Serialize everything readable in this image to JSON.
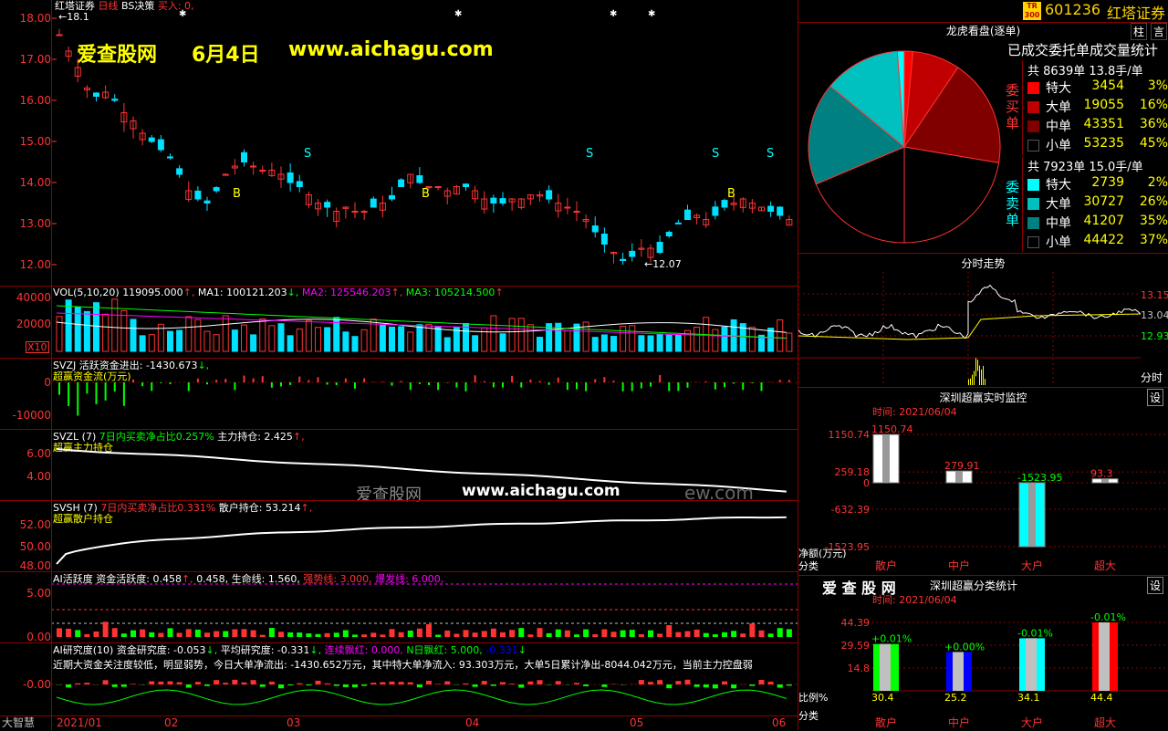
{
  "window": {
    "title": "红塔证券",
    "period": "日线",
    "strategy": "BS决策",
    "buy_label": "买入: 0,"
  },
  "header_right": {
    "code": "601236",
    "name": "红塔证券",
    "badge": "TR 300"
  },
  "watermark": {
    "site": "爱查股网",
    "date": "6月4日",
    "url": "www.aichagu.com",
    "mid_text": "爱查股网",
    "mid_url": "www.aichagu.com",
    "mid_tail": "ew.com"
  },
  "price_panel": {
    "y_ticks": [
      "18.00",
      "17.00",
      "16.00",
      "15.00",
      "14.00",
      "13.00",
      "12.00"
    ],
    "high_marker": "18.1",
    "low_marker": "12.07"
  },
  "vol_panel": {
    "label": "VOL(5,10,20)",
    "value": "119095.000",
    "ma1": "MA1: 100121.203",
    "ma2": "MA2: 125546.203",
    "ma3": "MA3: 105214.500",
    "y_ticks": [
      "40000",
      "20000"
    ],
    "unit": "X10"
  },
  "svzj_panel": {
    "label": "SVZJ  活跃资金进出: -1430.673",
    "sub": "超赢资金流(万元)",
    "y_ticks": [
      "0",
      "-10000"
    ]
  },
  "svzl_panel": {
    "label": "SVZL (7)",
    "ratio": "7日内买卖净占比0.257%",
    "hold": "主力持仓: 2.425",
    "sub": "超赢主力持仓",
    "y_ticks": [
      "6.00",
      "4.00"
    ]
  },
  "svsh_panel": {
    "label": "SVSH (7)",
    "ratio": "7日内买卖净占比0.331%",
    "hold": "散户持仓: 53.214",
    "sub": "超赢散户持仓",
    "y_ticks": [
      "52.00",
      "50.00",
      "48.00"
    ]
  },
  "ai_panel": {
    "label": "AI活跃度  资金活跃度: 0.458",
    "v2": "0.458,",
    "life": "生命线: 1.560,",
    "strong": "强势线: 3.000,",
    "burst": "爆发线: 6.000,",
    "y_ticks": [
      "5.00",
      "0.00"
    ]
  },
  "research_panel": {
    "label": "AI研究度(10) 资金研究度: -0.053",
    "avg": "平均研究度: -0.331",
    "red": "连续飘红: 0.000,",
    "nred": "N日飘红: 5.000,",
    "last": "-0.331",
    "note": "近期大资金关注度较低，明显弱势，今日大单净流出: -1430.652万元，其中特大单净流入: 93.303万元，大单5日累计净出-8044.042万元，当前主力控盘弱",
    "y_tick": "-0.00"
  },
  "x_axis": {
    "corner": "大智慧",
    "labels": [
      "2021/01",
      "02",
      "03",
      "04",
      "05",
      "06"
    ]
  },
  "dragon": {
    "title": "龙虎看盘(逐单)",
    "tab1": "柱",
    "tab2": "言",
    "subtitle": "已成交委托单成交量统计",
    "buy": {
      "side": "委买单",
      "total": "共 8639单 13.8手/单",
      "rows": [
        {
          "name": "特大",
          "value": "3454",
          "pct": "3%",
          "color": "#ff0000"
        },
        {
          "name": "大单",
          "value": "19055",
          "pct": "16%",
          "color": "#c00000"
        },
        {
          "name": "中单",
          "value": "43351",
          "pct": "36%",
          "color": "#800000"
        },
        {
          "name": "小单",
          "value": "53235",
          "pct": "45%",
          "color": "#000000"
        }
      ]
    },
    "sell": {
      "side": "委卖单",
      "total": "共 7923单 15.0手/单",
      "rows": [
        {
          "name": "特大",
          "value": "2739",
          "pct": "2%",
          "color": "#00ffff"
        },
        {
          "name": "大单",
          "value": "30727",
          "pct": "26%",
          "color": "#00c0c0"
        },
        {
          "name": "中单",
          "value": "41207",
          "pct": "35%",
          "color": "#008080"
        },
        {
          "name": "小单",
          "value": "44422",
          "pct": "37%",
          "color": "#000000"
        }
      ]
    }
  },
  "intraday": {
    "title": "分时走势",
    "y_ticks": [
      "13.15",
      "13.04",
      "12.935"
    ],
    "vol_label": "分时"
  },
  "realtime": {
    "title": "深圳超赢实时监控",
    "btn": "设",
    "time": "时间: 2021/06/04",
    "y_ticks": [
      "1150.74",
      "259.18",
      "0",
      "-632.39",
      "-1523.95"
    ],
    "y_label": "净额(万元)",
    "x_label": "分类",
    "categories": [
      "散户",
      "中户",
      "大户",
      "超大"
    ],
    "values": [
      1150.74,
      279.91,
      -1523.95,
      93.3
    ],
    "value_labels": [
      "1150.74",
      "279.91",
      "-1523.95",
      "93.3"
    ]
  },
  "classify": {
    "brand": "爱 查 股 网",
    "title": "深圳超赢分类统计",
    "btn": "设",
    "time": "时间: 2021/06/04",
    "y_ticks": [
      "44.39",
      "29.59",
      "14.8"
    ],
    "y_label": "比例%",
    "x_label": "分类",
    "categories": [
      "散户",
      "中户",
      "大户",
      "超大"
    ],
    "values": [
      30.4,
      25.2,
      34.1,
      44.4
    ],
    "value_labels": [
      "30.4",
      "25.2",
      "34.1",
      "44.4"
    ],
    "change_labels": [
      "+0.01%",
      "+0.00%",
      "-0.01%",
      "-0.01%"
    ],
    "colors": [
      "#00ff00",
      "#0000ff",
      "#00ffff",
      "#ff0000"
    ]
  }
}
